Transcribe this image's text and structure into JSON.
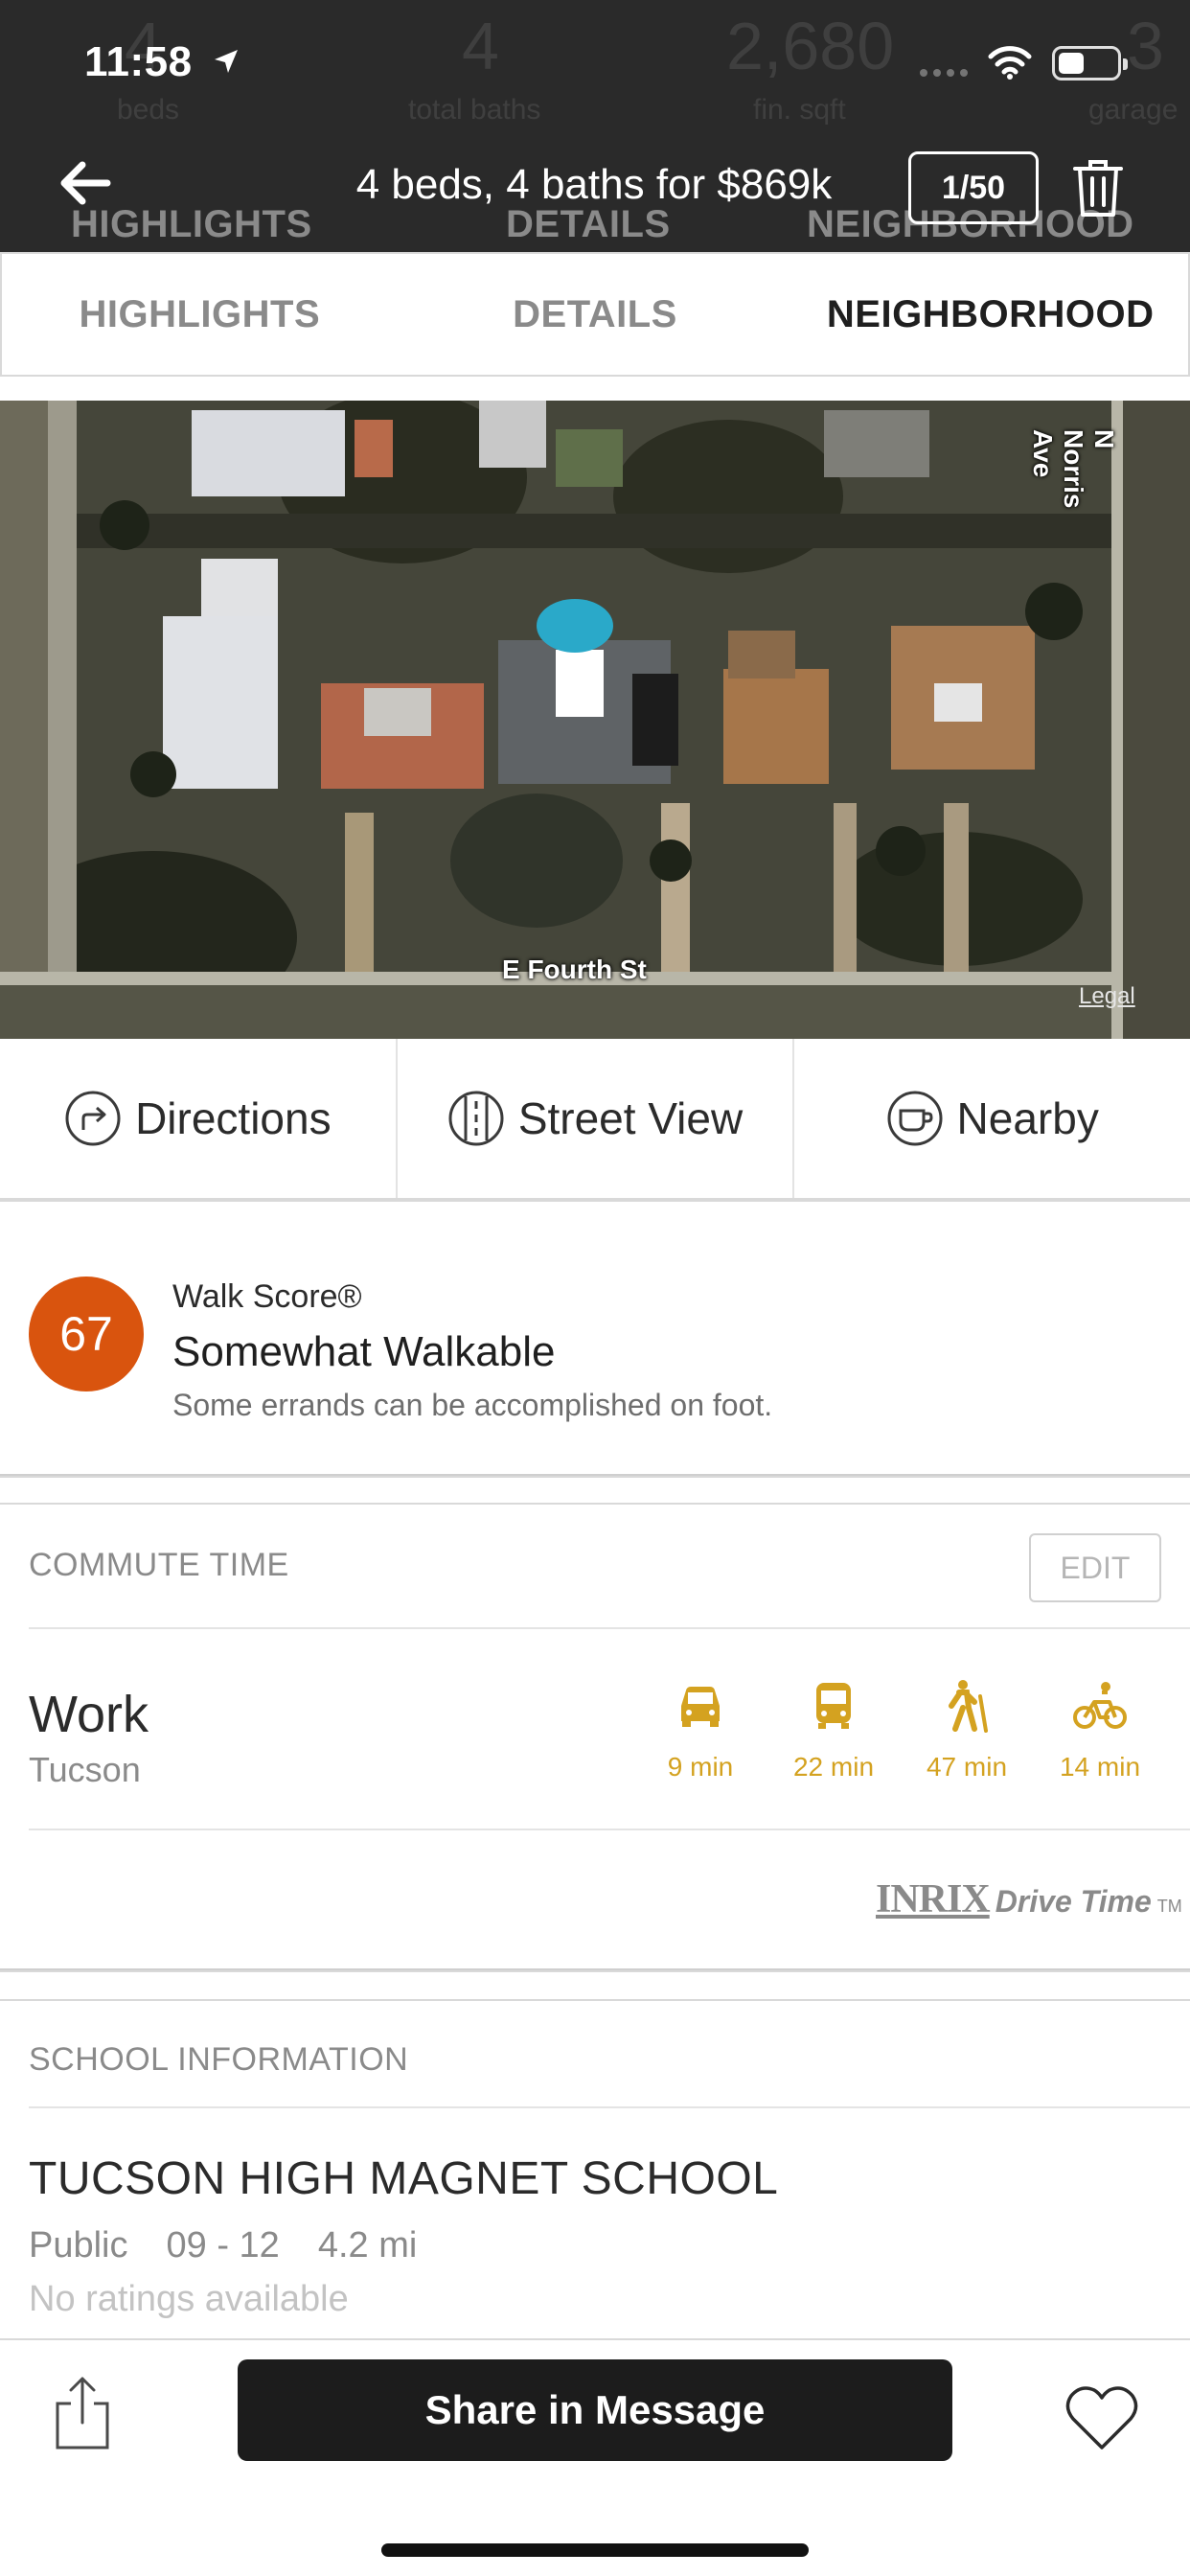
{
  "status_bar": {
    "time": "11:58",
    "icons": [
      "location-arrow-icon",
      "signal-icon",
      "wifi-icon",
      "battery-icon"
    ]
  },
  "header": {
    "background_facts": [
      {
        "value": "4",
        "label": "beds"
      },
      {
        "value": "4",
        "label": "total baths"
      },
      {
        "value": "2,680",
        "label": "fin. sqft"
      },
      {
        "value": "3",
        "label": "garage"
      }
    ],
    "title": "4 beds, 4 baths for $869k",
    "counter": "1/50",
    "icons": [
      "back-arrow-icon",
      "trash-icon"
    ]
  },
  "tabs": [
    {
      "label": "HIGHLIGHTS",
      "active": false
    },
    {
      "label": "DETAILS",
      "active": false
    },
    {
      "label": "NEIGHBORHOOD",
      "active": true
    }
  ],
  "map": {
    "street_horizontal": "E Fourth St",
    "street_vertical": "N Norris Ave",
    "legal": "Legal"
  },
  "actions": [
    {
      "label": "Directions",
      "icon": "directions-icon"
    },
    {
      "label": "Street View",
      "icon": "street-view-icon"
    },
    {
      "label": "Nearby",
      "icon": "coffee-cup-icon"
    }
  ],
  "walk_score": {
    "score": "67",
    "label": "Walk Score®",
    "description": "Somewhat Walkable",
    "detail": "Some errands can be accomplished on foot.",
    "badge_color": "#d9540e"
  },
  "commute": {
    "section_title": "COMMUTE TIME",
    "edit_label": "EDIT",
    "destination": "Work",
    "city": "Tucson",
    "modes": [
      {
        "icon": "car-icon",
        "time": "9 min"
      },
      {
        "icon": "bus-icon",
        "time": "22 min"
      },
      {
        "icon": "walking-icon",
        "time": "47 min"
      },
      {
        "icon": "bicycle-icon",
        "time": "14 min"
      }
    ],
    "mode_color": "#d4a220",
    "provider_logo": "INRIX",
    "provider_text": "Drive Time",
    "provider_tm": "TM"
  },
  "schools": {
    "section_title": "SCHOOL INFORMATION",
    "items": [
      {
        "name": "TUCSON HIGH MAGNET SCHOOL",
        "type": "Public",
        "grades": "09 - 12",
        "distance": "4.2 mi",
        "rating": "No ratings available"
      }
    ]
  },
  "bottom_bar": {
    "share_label": "Share in Message",
    "icons": [
      "share-icon",
      "heart-icon"
    ]
  }
}
